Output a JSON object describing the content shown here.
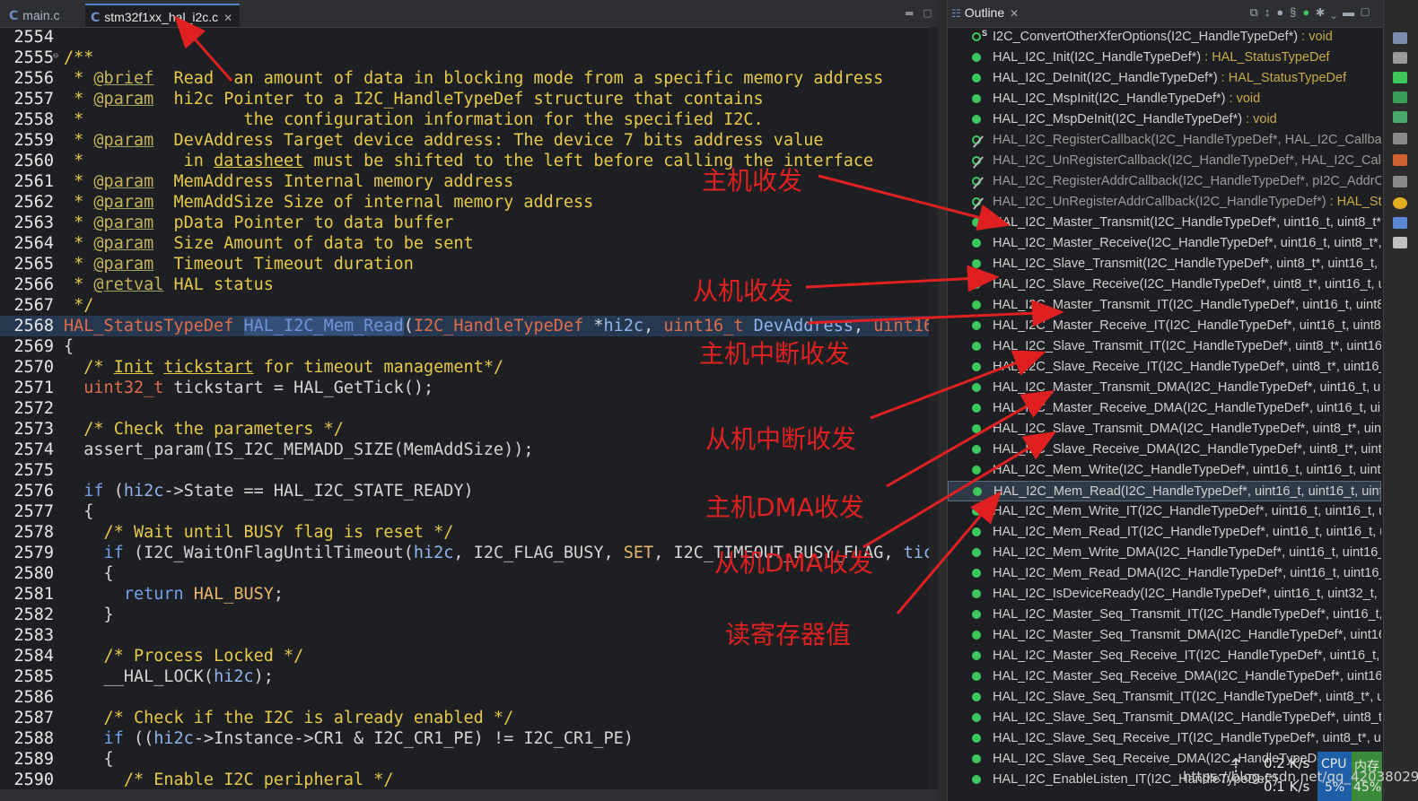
{
  "tabs": [
    {
      "label": "main.c"
    },
    {
      "label": "stm32f1xx_hal_i2c.c",
      "close": "✕"
    }
  ],
  "code_lines": [
    {
      "n": "2554"
    },
    {
      "n": "2555"
    },
    {
      "n": "2556"
    },
    {
      "n": "2557"
    },
    {
      "n": "2558"
    },
    {
      "n": "2559"
    },
    {
      "n": "2560"
    },
    {
      "n": "2561"
    },
    {
      "n": "2562"
    },
    {
      "n": "2563"
    },
    {
      "n": "2564"
    },
    {
      "n": "2565"
    },
    {
      "n": "2566"
    },
    {
      "n": "2567"
    },
    {
      "n": "2568"
    },
    {
      "n": "2569"
    },
    {
      "n": "2570"
    },
    {
      "n": "2571"
    },
    {
      "n": "2572"
    },
    {
      "n": "2573"
    },
    {
      "n": "2574"
    },
    {
      "n": "2575"
    },
    {
      "n": "2576"
    },
    {
      "n": "2577"
    },
    {
      "n": "2578"
    },
    {
      "n": "2579"
    },
    {
      "n": "2580"
    },
    {
      "n": "2581"
    },
    {
      "n": "2582"
    },
    {
      "n": "2583"
    },
    {
      "n": "2584"
    },
    {
      "n": "2585"
    },
    {
      "n": "2586"
    },
    {
      "n": "2587"
    },
    {
      "n": "2588"
    },
    {
      "n": "2589"
    },
    {
      "n": "2590"
    }
  ],
  "code": {
    "l2555": "/**",
    "l2556a": " * ",
    "l2556t": "@brief",
    "l2556b": "  Read  an amount of data in blocking mode from a specific memory address",
    "l2557a": " * ",
    "l2557t": "@param",
    "l2557b": "  hi2c Pointer to a I2C_HandleTypeDef structure that contains",
    "l2558": " *                the configuration information for the specified I2C.",
    "l2559a": " * ",
    "l2559t": "@param",
    "l2559b": "  DevAddress Target device address: The device 7 bits address value",
    "l2560a": " *          in ",
    "l2560u": "datasheet",
    "l2560b": " must be shifted to the left before calling the interface",
    "l2561a": " * ",
    "l2561t": "@param",
    "l2561b": "  MemAddress Internal memory address",
    "l2562a": " * ",
    "l2562t": "@param",
    "l2562b": "  MemAddSize Size of internal memory address",
    "l2563a": " * ",
    "l2563t": "@param",
    "l2563b": "  pData Pointer to data buffer",
    "l2564a": " * ",
    "l2564t": "@param",
    "l2564b": "  Size Amount of data to be sent",
    "l2565a": " * ",
    "l2565t": "@param",
    "l2565b": "  Timeout Timeout duration",
    "l2566a": " * ",
    "l2566t": "@retval",
    "l2566b": " HAL status",
    "l2567": " */",
    "l2568_type": "HAL_StatusTypeDef",
    "l2568_fn": "HAL_I2C_Mem_Read",
    "l2568_p1": "(",
    "l2568_t1": "I2C_HandleTypeDef",
    "l2568_p2": " *",
    "l2568_v1": "hi2c",
    "l2568_p3": ", ",
    "l2568_t2": "uint16_t",
    "l2568_p4": " ",
    "l2568_v2": "DevAddress",
    "l2568_p5": ", ",
    "l2568_t3": "uint16_",
    "l2569": "{",
    "l2570a": "  /* ",
    "l2570u1": "Init",
    "l2570s": " ",
    "l2570u2": "tickstart",
    "l2570b": " for timeout management*/",
    "l2571_ty": "  uint32_t",
    "l2571_rest": " tickstart = HAL_GetTick();",
    "l2573": "  /* Check the parameters */",
    "l2574": "  assert_param(IS_I2C_MEMADD_SIZE(MemAddSize));",
    "l2576_kw": "  if",
    "l2576_a": " (",
    "l2576_v": "hi2c",
    "l2576_b": "->State == HAL_I2C_STATE_READY)",
    "l2577": "  {",
    "l2578": "    /* Wait until BUSY flag is reset */",
    "l2579_kw": "    if",
    "l2579_a": " (I2C_WaitOnFlagUntilTimeout(",
    "l2579_v": "hi2c",
    "l2579_b": ", I2C_FLAG_BUSY, ",
    "l2579_m": "SET",
    "l2579_c": ", I2C_TIMEOUT_BUSY_FLAG, ",
    "l2579_v2": "tick",
    "l2580": "    {",
    "l2581_kw": "      return",
    "l2581_m": " HAL_BUSY",
    "l2581_b": ";",
    "l2582": "    }",
    "l2584": "    /* Process Locked */",
    "l2585_a": "    __HAL_LOCK(",
    "l2585_v": "hi2c",
    "l2585_b": ");",
    "l2587": "    /* Check if the I2C is already enabled */",
    "l2588_kw": "    if",
    "l2588_a": " ((",
    "l2588_v": "hi2c",
    "l2588_b": "->Instance->CR1 & I2C_CR1_PE) != I2C_CR1_PE)",
    "l2589": "    {",
    "l2590": "      /* Enable I2C peripheral */"
  },
  "outline": {
    "title": "Outline",
    "items": [
      {
        "name": "I2C_ConvertOtherXferOptions(I2C_HandleTypeDef*)",
        "ret": " : void",
        "kind": "static"
      },
      {
        "name": "HAL_I2C_Init(I2C_HandleTypeDef*)",
        "ret": " : HAL_StatusTypeDef",
        "kind": "pub"
      },
      {
        "name": "HAL_I2C_DeInit(I2C_HandleTypeDef*)",
        "ret": " : HAL_StatusTypeDef",
        "kind": "pub"
      },
      {
        "name": "HAL_I2C_MspInit(I2C_HandleTypeDef*)",
        "ret": " : void",
        "kind": "pub"
      },
      {
        "name": "HAL_I2C_MspDeInit(I2C_HandleTypeDef*)",
        "ret": " : void",
        "kind": "pub"
      },
      {
        "name": "HAL_I2C_RegisterCallback(I2C_HandleTypeDef*, HAL_I2C_Callback",
        "ret": "",
        "kind": "inactive"
      },
      {
        "name": "HAL_I2C_UnRegisterCallback(I2C_HandleTypeDef*, HAL_I2C_Callb",
        "ret": "",
        "kind": "inactive"
      },
      {
        "name": "HAL_I2C_RegisterAddrCallback(I2C_HandleTypeDef*, pI2C_AddrCa",
        "ret": "",
        "kind": "inactive"
      },
      {
        "name": "HAL_I2C_UnRegisterAddrCallback(I2C_HandleTypeDef*)",
        "ret": " : HAL_Sta",
        "kind": "inactive"
      },
      {
        "name": "HAL_I2C_Master_Transmit(I2C_HandleTypeDef*, uint16_t, uint8_t*, u",
        "ret": "",
        "kind": "pub"
      },
      {
        "name": "HAL_I2C_Master_Receive(I2C_HandleTypeDef*, uint16_t, uint8_t*, u",
        "ret": "",
        "kind": "pub"
      },
      {
        "name": "HAL_I2C_Slave_Transmit(I2C_HandleTypeDef*, uint8_t*, uint16_t, ui",
        "ret": "",
        "kind": "pub"
      },
      {
        "name": "HAL_I2C_Slave_Receive(I2C_HandleTypeDef*, uint8_t*, uint16_t, uir",
        "ret": "",
        "kind": "pub"
      },
      {
        "name": "HAL_I2C_Master_Transmit_IT(I2C_HandleTypeDef*, uint16_t, uint8_t",
        "ret": "",
        "kind": "pub"
      },
      {
        "name": "HAL_I2C_Master_Receive_IT(I2C_HandleTypeDef*, uint16_t, uint8_t",
        "ret": "",
        "kind": "pub"
      },
      {
        "name": "HAL_I2C_Slave_Transmit_IT(I2C_HandleTypeDef*, uint8_t*, uint16_t",
        "ret": "",
        "kind": "pub"
      },
      {
        "name": "HAL_I2C_Slave_Receive_IT(I2C_HandleTypeDef*, uint8_t*, uint16_t)",
        "ret": "",
        "kind": "pub"
      },
      {
        "name": "HAL_I2C_Master_Transmit_DMA(I2C_HandleTypeDef*, uint16_t, uin",
        "ret": "",
        "kind": "pub"
      },
      {
        "name": "HAL_I2C_Master_Receive_DMA(I2C_HandleTypeDef*, uint16_t, uint",
        "ret": "",
        "kind": "pub"
      },
      {
        "name": "HAL_I2C_Slave_Transmit_DMA(I2C_HandleTypeDef*, uint8_t*, uint1",
        "ret": "",
        "kind": "pub"
      },
      {
        "name": "HAL_I2C_Slave_Receive_DMA(I2C_HandleTypeDef*, uint8_t*, uint1(",
        "ret": "",
        "kind": "pub"
      },
      {
        "name": "HAL_I2C_Mem_Write(I2C_HandleTypeDef*, uint16_t, uint16_t, uint1",
        "ret": "",
        "kind": "pub"
      },
      {
        "name": "HAL_I2C_Mem_Read(I2C_HandleTypeDef*, uint16_t, uint16_t, uint1",
        "ret": "",
        "kind": "pub",
        "selected": true
      },
      {
        "name": "HAL_I2C_Mem_Write_IT(I2C_HandleTypeDef*, uint16_t, uint16_t, ui",
        "ret": "",
        "kind": "pub"
      },
      {
        "name": "HAL_I2C_Mem_Read_IT(I2C_HandleTypeDef*, uint16_t, uint16_t, uir",
        "ret": "",
        "kind": "pub"
      },
      {
        "name": "HAL_I2C_Mem_Write_DMA(I2C_HandleTypeDef*, uint16_t, uint16_t",
        "ret": "",
        "kind": "pub"
      },
      {
        "name": "HAL_I2C_Mem_Read_DMA(I2C_HandleTypeDef*, uint16_t, uint16_t",
        "ret": "",
        "kind": "pub"
      },
      {
        "name": "HAL_I2C_IsDeviceReady(I2C_HandleTypeDef*, uint16_t, uint32_t, ui",
        "ret": "",
        "kind": "pub"
      },
      {
        "name": "HAL_I2C_Master_Seq_Transmit_IT(I2C_HandleTypeDef*, uint16_t, ui",
        "ret": "",
        "kind": "pub"
      },
      {
        "name": "HAL_I2C_Master_Seq_Transmit_DMA(I2C_HandleTypeDef*, uint16_",
        "ret": "",
        "kind": "pub"
      },
      {
        "name": "HAL_I2C_Master_Seq_Receive_IT(I2C_HandleTypeDef*, uint16_t, uir",
        "ret": "",
        "kind": "pub"
      },
      {
        "name": "HAL_I2C_Master_Seq_Receive_DMA(I2C_HandleTypeDef*, uint16_t",
        "ret": "",
        "kind": "pub"
      },
      {
        "name": "HAL_I2C_Slave_Seq_Transmit_IT(I2C_HandleTypeDef*, uint8_t*, uint",
        "ret": "",
        "kind": "pub"
      },
      {
        "name": "HAL_I2C_Slave_Seq_Transmit_DMA(I2C_HandleTypeDef*, uint8_t*,",
        "ret": "",
        "kind": "pub"
      },
      {
        "name": "HAL_I2C_Slave_Seq_Receive_IT(I2C_HandleTypeDef*, uint8_t*, uint",
        "ret": "",
        "kind": "pub"
      },
      {
        "name": "HAL_I2C_Slave_Seq_Receive_DMA(I2C_HandleTypeDef*, uint8_t*, u",
        "ret": "",
        "kind": "pub"
      },
      {
        "name": "HAL_I2C_EnableListen_IT(I2C_HandleTypeDef*)",
        "ret": "",
        "kind": "pub"
      }
    ]
  },
  "annotations": {
    "master_rxtx": "主机收发",
    "slave_rxtx": "从机收发",
    "master_it": "主机中断收发",
    "slave_it": "从机中断收发",
    "master_dma": "主机DMA收发",
    "slave_dma": "从机DMA收发",
    "read_reg": "读寄存器值"
  },
  "netmon": {
    "up": "0.2 K/s",
    "down": "0.1 K/s",
    "cpu_label": "CPU",
    "cpu": "5%",
    "mem_label": "内存",
    "mem": "45%"
  },
  "watermark": "https://blog.csdn.net/qq_42038029",
  "colors": {
    "accent_red": "#e02020",
    "status_green": "#3cc85a",
    "comment_yellow": "#e6c84a"
  }
}
